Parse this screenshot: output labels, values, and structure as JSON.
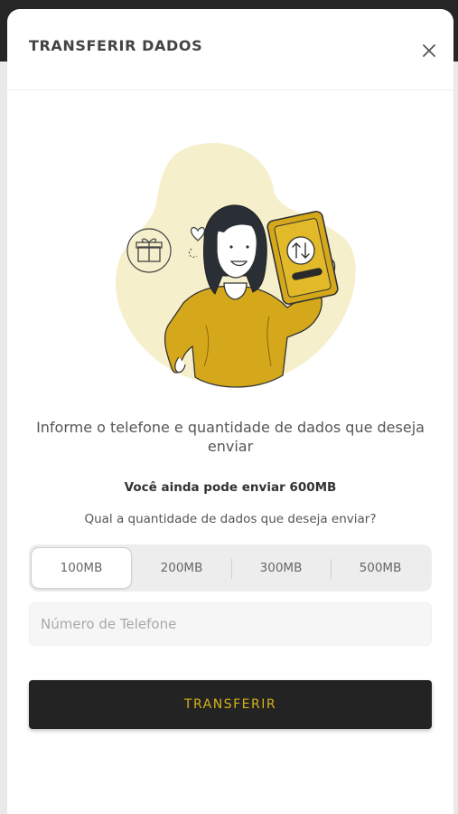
{
  "modal": {
    "title": "TRANSFERIR DADOS",
    "close_icon": "close-icon"
  },
  "illustration": {
    "subject": "woman-holding-phone-with-transfer-arrows",
    "icons": [
      "gift-icon",
      "heart-icon",
      "transfer-arrows-icon"
    ]
  },
  "content": {
    "headline": "Informe o telefone e quantidade de dados que deseja enviar",
    "remaining": "Você ainda pode enviar 600MB",
    "question": "Qual a quantidade de dados que deseja enviar?"
  },
  "data_options": [
    {
      "label": "100MB",
      "selected": true
    },
    {
      "label": "200MB",
      "selected": false
    },
    {
      "label": "300MB",
      "selected": false
    },
    {
      "label": "500MB",
      "selected": false
    }
  ],
  "phone_field": {
    "placeholder": "Número de Telefone",
    "value": ""
  },
  "submit": {
    "label": "TRANSFERIR"
  },
  "colors": {
    "accent": "#d6b31a",
    "illustration_yellow": "#d4a81a",
    "blob": "#f6efcc",
    "button_bg": "#232323"
  }
}
